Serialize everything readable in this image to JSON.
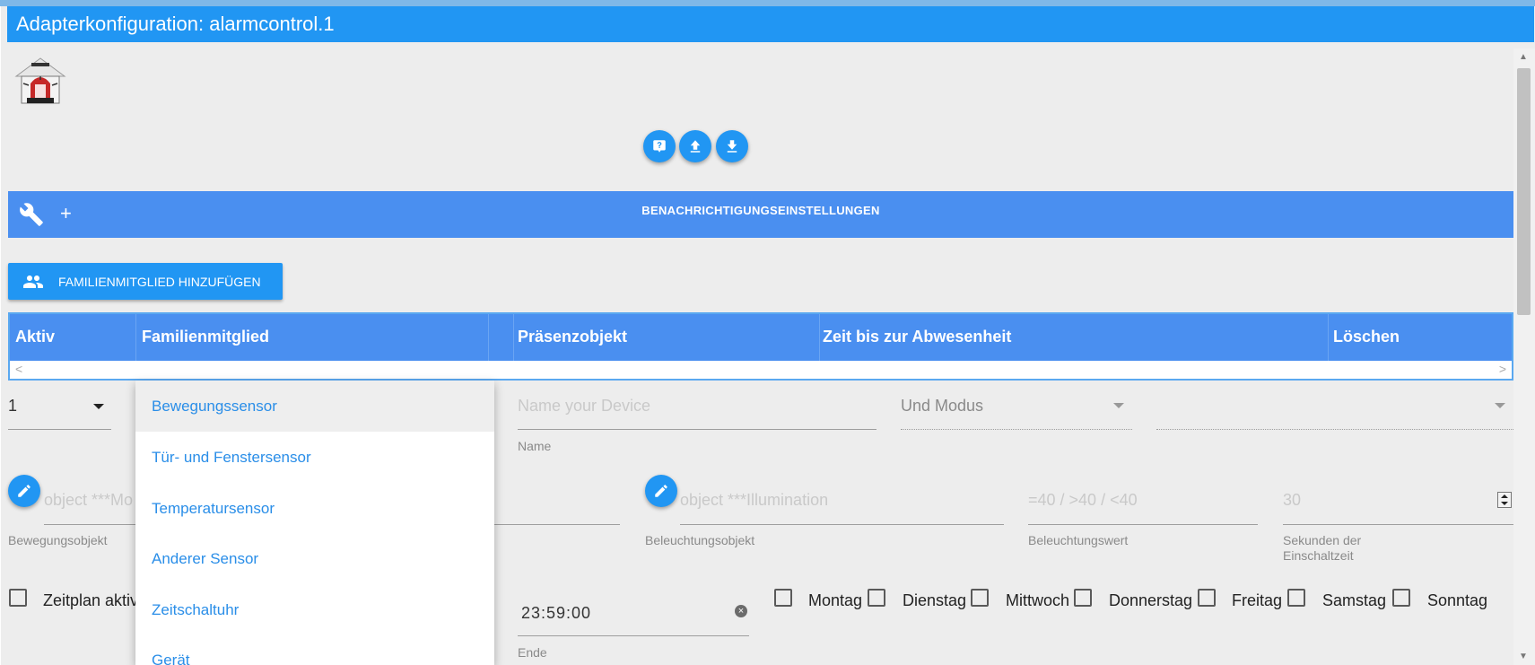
{
  "window": {
    "title": "Adapterkonfiguration: alarmcontrol.1"
  },
  "toolbar": {
    "icons": [
      "help-icon",
      "upload-icon",
      "download-icon"
    ]
  },
  "notification_bar": {
    "title": "BENACHRICHTIGUNGSEINSTELLUNGEN",
    "plus": "+"
  },
  "add_family_button": {
    "label": "FAMILIENMITGLIED HINZUFÜGEN"
  },
  "table": {
    "headers": [
      "Aktiv",
      "Familienmitglied",
      "Präsenzobjekt",
      "Zeit bis zur Abwesenheit",
      "Löschen"
    ]
  },
  "row1": {
    "number_select": "1",
    "name_placeholder": "Name your Device",
    "name_label": "Name",
    "mode_select": "Und Modus"
  },
  "row2": {
    "motion_placeholder": "object ***Mo",
    "motion_label": "Bewegungsobjekt",
    "illumination_placeholder": "object ***Illumination",
    "illumination_label": "Beleuchtungsobjekt",
    "illumination_value_placeholder": "=40 / >40 / <40",
    "illumination_value_label": "Beleuchtungswert",
    "seconds_value": "30",
    "seconds_label_line1": "Sekunden der",
    "seconds_label_line2": "Einschaltzeit"
  },
  "row3": {
    "schedule_label": "Zeitplan aktiv",
    "end_time": "23:59:00",
    "end_label": "Ende",
    "days": [
      "Montag",
      "Dienstag",
      "Mittwoch",
      "Donnerstag",
      "Freitag",
      "Samstag",
      "Sonntag"
    ]
  },
  "dropdown": {
    "options": [
      "Bewegungssensor",
      "Tür- und Fenstersensor",
      "Temperatursensor",
      "Anderer Sensor",
      "Zeitschaltuhr",
      "Gerät"
    ],
    "selected_index": 0
  },
  "colors": {
    "primary": "#2196f3",
    "header": "#4a8ff0",
    "background": "#ededed"
  }
}
